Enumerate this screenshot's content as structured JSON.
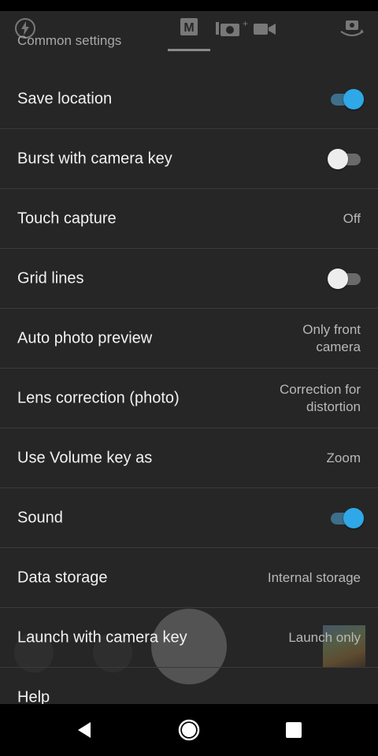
{
  "header": {
    "section_title": "Common settings",
    "mode_label": "M",
    "icons": [
      "flash-icon",
      "manual-mode-icon",
      "photo-plus-icon",
      "video-icon",
      "switch-camera-icon"
    ]
  },
  "settings": [
    {
      "label": "Save location",
      "type": "toggle",
      "on": true
    },
    {
      "label": "Burst with camera key",
      "type": "toggle",
      "on": false
    },
    {
      "label": "Touch capture",
      "type": "value",
      "value": "Off"
    },
    {
      "label": "Grid lines",
      "type": "toggle",
      "on": false
    },
    {
      "label": "Auto photo preview",
      "type": "value",
      "value": "Only front camera"
    },
    {
      "label": "Lens correction (photo)",
      "type": "value",
      "value": "Correction for distortion"
    },
    {
      "label": "Use Volume key as",
      "type": "value",
      "value": "Zoom"
    },
    {
      "label": "Sound",
      "type": "toggle",
      "on": true
    },
    {
      "label": "Data storage",
      "type": "value",
      "value": "Internal storage"
    },
    {
      "label": "Launch with camera key",
      "type": "value",
      "value": "Launch only"
    },
    {
      "label": "Help",
      "type": "link"
    }
  ],
  "colors": {
    "background": "#262626",
    "toggle_on": "#2fa8e8",
    "toggle_off": "#ededed",
    "divider": "#3a3a3a"
  },
  "navbar": {
    "icons": [
      "back-icon",
      "home-icon",
      "recent-apps-icon"
    ]
  }
}
